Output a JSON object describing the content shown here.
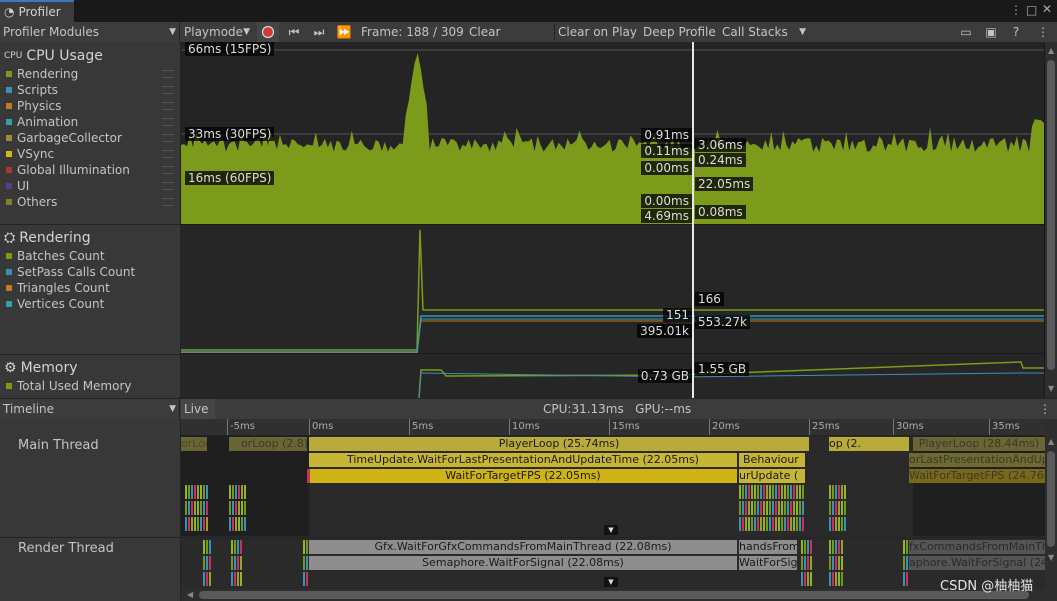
{
  "window": {
    "tab_title": "Profiler"
  },
  "toolbar": {
    "modules_label": "Profiler Modules",
    "mode_label": "Playmode",
    "frame_label": "Frame: 188 / 309",
    "clear_label": "Clear",
    "clear_on_play_label": "Clear on Play",
    "deep_profile_label": "Deep Profile",
    "call_stacks_label": "Call Stacks"
  },
  "modules": [
    {
      "title": "CPU Usage",
      "items": [
        {
          "label": "Rendering",
          "color": "#7d9b1a"
        },
        {
          "label": "Scripts",
          "color": "#3c8fb8"
        },
        {
          "label": "Physics",
          "color": "#c07a1f"
        },
        {
          "label": "Animation",
          "color": "#2ea2a6"
        },
        {
          "label": "GarbageCollector",
          "color": "#a08a3a"
        },
        {
          "label": "VSync",
          "color": "#d6b712"
        },
        {
          "label": "Global Illumination",
          "color": "#a33b2a"
        },
        {
          "label": "UI",
          "color": "#5a3d8c"
        },
        {
          "label": "Others",
          "color": "#837f2a"
        }
      ]
    },
    {
      "title": "Rendering",
      "items": [
        {
          "label": "Batches Count",
          "color": "#7d9b1a"
        },
        {
          "label": "SetPass Calls Count",
          "color": "#3c8fb8"
        },
        {
          "label": "Triangles Count",
          "color": "#c07a1f"
        },
        {
          "label": "Vertices Count",
          "color": "#2ea2a6"
        }
      ]
    },
    {
      "title": "Memory",
      "items": [
        {
          "label": "Total Used Memory",
          "color": "#7d9b1a"
        }
      ]
    }
  ],
  "cpu_chart": {
    "ref_lines": [
      "66ms (15FPS)",
      "33ms (30FPS)",
      "16ms (60FPS)"
    ],
    "left_values": [
      "0.91ms",
      "0.11ms",
      "0.00ms",
      "0.00ms",
      "4.69ms"
    ],
    "right_values": [
      "3.06ms",
      "0.24ms",
      "22.05ms",
      "0.08ms"
    ]
  },
  "render_chart": {
    "values": [
      "166",
      "151",
      "553.27k",
      "395.01k"
    ]
  },
  "memory_chart": {
    "values": [
      "0.73 GB",
      "1.55 GB"
    ]
  },
  "timeline_bar": {
    "view_label": "Timeline",
    "live_label": "Live",
    "cpu_gpu_label": "CPU:31.13ms   GPU:--ms"
  },
  "timeline": {
    "threads": [
      "Main Thread",
      "Render Thread"
    ],
    "ruler_ticks": [
      "-5ms",
      "0ms",
      "5ms",
      "10ms",
      "15ms",
      "20ms",
      "25ms",
      "30ms",
      "35ms"
    ],
    "main_bars": [
      {
        "label": "PlayerLoop (25.74ms)"
      },
      {
        "label": "TimeUpdate.WaitForLastPresentationAndUpdateTime (22.05ms)"
      },
      {
        "label": "WaitForTargetFPS (22.05ms)"
      },
      {
        "label": "orLoop (2.8)"
      },
      {
        "label": "orLoop (2.8)"
      },
      {
        "label": "PlayerLoop (28.44ms)"
      },
      {
        "label": "orLastPresentationAndUpdateTime"
      },
      {
        "label": "WaitForTargetFPS (24.76ms"
      },
      {
        "label": "Behaviour"
      },
      {
        "label": "urUpdate ("
      },
      {
        "label": "op (2."
      }
    ],
    "render_bars": [
      {
        "label": "Gfx.WaitForGfxCommandsFromMainThread (22.08ms)"
      },
      {
        "label": "Semaphore.WaitForSignal (22.08ms)"
      },
      {
        "label": "handsFromM"
      },
      {
        "label": "WaitForSign"
      },
      {
        "label": "fxCommandsFromMainThre"
      },
      {
        "label": "aphore.WaitForSignal (24.7"
      }
    ]
  },
  "watermark": "CSDN @柚柚猫"
}
